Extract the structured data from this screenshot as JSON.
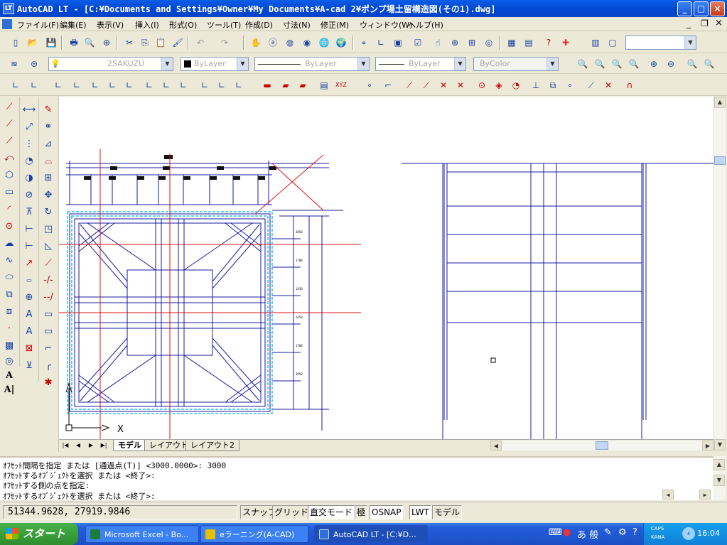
{
  "window": {
    "title": "AutoCAD LT - [C:¥Documents and Settings¥Owner¥My Documents¥A-cad 2¥ポンプ場土留構造図(その1).dwg]",
    "app_icon_label": "LT",
    "controls": {
      "minimize": "_",
      "maximize": "□",
      "close": "×"
    }
  },
  "menubar": {
    "items": [
      "ファイル(F)",
      "編集(E)",
      "表示(V)",
      "挿入(I)",
      "形式(O)",
      "ツール(T)",
      "作成(D)",
      "寸法(N)",
      "修正(M)",
      "ウィンドウ(W)",
      "ヘルプ(H)"
    ],
    "doc_controls": {
      "minimize": "_",
      "restore": "❐",
      "close": "×"
    }
  },
  "layers_toolbar": {
    "layer_name": "2SAKUZU",
    "color": "ByLayer",
    "linetype": "ByLayer",
    "lineweight": "ByLayer",
    "plotstyle": "ByColor"
  },
  "drawing": {
    "ucs_label": "X"
  },
  "layout_tabs": [
    "モデル",
    "レイアウト1",
    "レイアウト2"
  ],
  "command_history": [
    "ｵﾌｾｯﾄ間隔を指定 または [通過点(T)] <3000.0000>: 3000",
    "ｵﾌｾｯﾄするｵﾌﾞｼﾞｪｸﾄを選択 または <終了>:",
    "ｵﾌｾｯﾄする側の点を指定:",
    "ｵﾌｾｯﾄするｵﾌﾞｼﾞｪｸﾄを選択 または <終了>:"
  ],
  "status": {
    "coordinates": "51344.9628, 27919.9846",
    "toggles": [
      "スナップ",
      "グリッド",
      "直交モード",
      "極",
      "OSNAP",
      "LWT",
      "モデル"
    ]
  },
  "taskbar": {
    "start": "スタート",
    "tasks": [
      "Microsoft Excel - Bo...",
      "eラーニング(A-CAD)",
      "AutoCAD LT - [C:¥D..."
    ],
    "ime": "あ 般",
    "caps": "CAPS",
    "kana": "KANA",
    "clock": "16:04"
  },
  "colors": {
    "title_blue": "#0a5ee8",
    "cad_blue": "#1a1aa0",
    "cad_red": "#e01010",
    "cad_cyan": "#30b8e0"
  }
}
